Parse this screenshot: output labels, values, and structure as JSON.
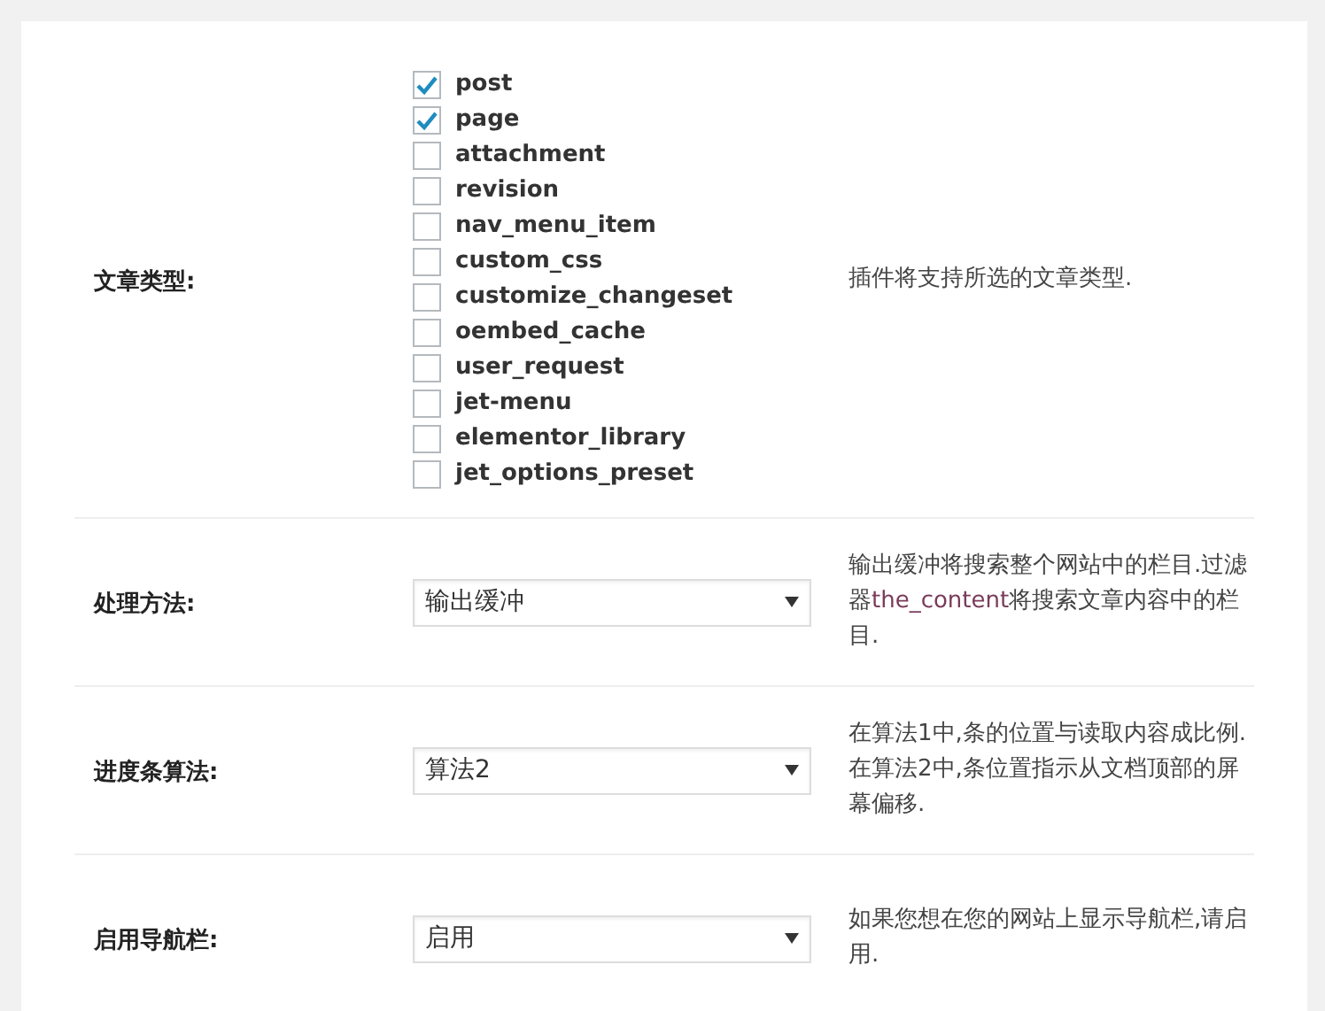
{
  "settings": [
    {
      "kind": "checklist",
      "label": "文章类型:",
      "options": [
        {
          "label": "post",
          "checked": true
        },
        {
          "label": "page",
          "checked": true
        },
        {
          "label": "attachment",
          "checked": false
        },
        {
          "label": "revision",
          "checked": false
        },
        {
          "label": "nav_menu_item",
          "checked": false
        },
        {
          "label": "custom_css",
          "checked": false
        },
        {
          "label": "customize_changeset",
          "checked": false
        },
        {
          "label": "oembed_cache",
          "checked": false
        },
        {
          "label": "user_request",
          "checked": false
        },
        {
          "label": "jet-menu",
          "checked": false
        },
        {
          "label": "elementor_library",
          "checked": false
        },
        {
          "label": "jet_options_preset",
          "checked": false
        }
      ],
      "description": [
        {
          "kind": "plain",
          "text": "插件将支持所选的文章类型."
        }
      ]
    },
    {
      "kind": "select",
      "label": "处理方法:",
      "value": "输出缓冲",
      "description": [
        {
          "kind": "plain",
          "text": "输出缓冲将搜索整个网站中的栏目.过滤器"
        },
        {
          "kind": "code",
          "text": "the_content"
        },
        {
          "kind": "plain",
          "text": "将搜索文章内容中的栏目."
        }
      ]
    },
    {
      "kind": "select",
      "label": "进度条算法:",
      "value": "算法2",
      "description": [
        {
          "kind": "plain",
          "text": "在算法1中,条的位置与读取内容成比例.在算法2中,条位置指示从文档顶部的屏幕偏移."
        }
      ]
    },
    {
      "kind": "select",
      "label": "启用导航栏:",
      "value": "启用",
      "description": [
        {
          "kind": "plain",
          "text": "如果您想在您的网站上显示导航栏,请启用."
        }
      ]
    }
  ]
}
